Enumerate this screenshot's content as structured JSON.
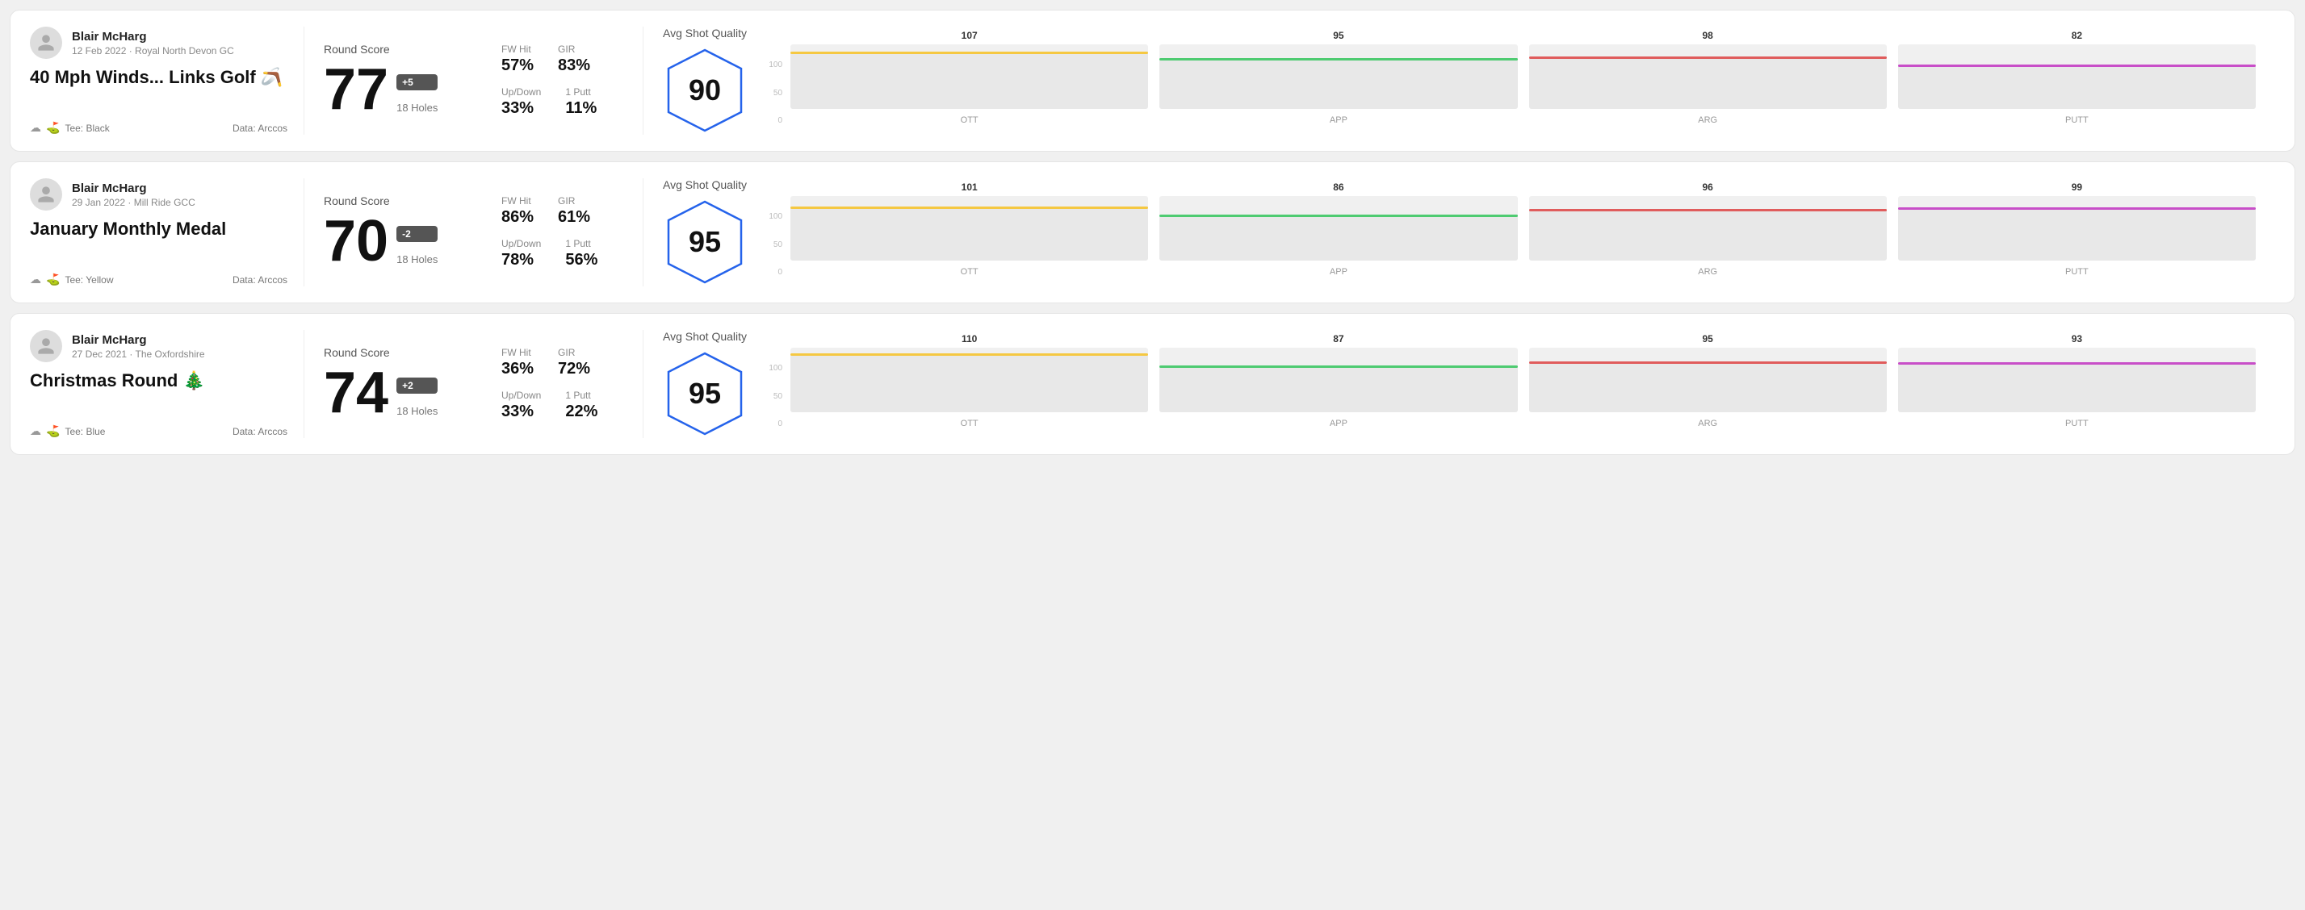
{
  "rounds": [
    {
      "id": "round-1",
      "player": "Blair McHarg",
      "date": "12 Feb 2022 · Royal North Devon GC",
      "title": "40 Mph Winds... Links Golf 🪃",
      "tee": "Black",
      "data_source": "Data: Arccos",
      "round_score_label": "Round Score",
      "score": "77",
      "score_diff": "+5",
      "holes": "18 Holes",
      "fw_hit_label": "FW Hit",
      "fw_hit": "57%",
      "gir_label": "GIR",
      "gir": "83%",
      "updown_label": "Up/Down",
      "updown": "33%",
      "oneputt_label": "1 Putt",
      "oneputt": "11%",
      "quality_label": "Avg Shot Quality",
      "quality_score": "90",
      "bars": [
        {
          "label": "OTT",
          "value": 107,
          "color": "#f5c842"
        },
        {
          "label": "APP",
          "value": 95,
          "color": "#4ecb71"
        },
        {
          "label": "ARG",
          "value": 98,
          "color": "#e05c5c"
        },
        {
          "label": "PUTT",
          "value": 82,
          "color": "#c84ec8"
        }
      ],
      "chart_max": 100
    },
    {
      "id": "round-2",
      "player": "Blair McHarg",
      "date": "29 Jan 2022 · Mill Ride GCC",
      "title": "January Monthly Medal",
      "tee": "Yellow",
      "data_source": "Data: Arccos",
      "round_score_label": "Round Score",
      "score": "70",
      "score_diff": "-2",
      "holes": "18 Holes",
      "fw_hit_label": "FW Hit",
      "fw_hit": "86%",
      "gir_label": "GIR",
      "gir": "61%",
      "updown_label": "Up/Down",
      "updown": "78%",
      "oneputt_label": "1 Putt",
      "oneputt": "56%",
      "quality_label": "Avg Shot Quality",
      "quality_score": "95",
      "bars": [
        {
          "label": "OTT",
          "value": 101,
          "color": "#f5c842"
        },
        {
          "label": "APP",
          "value": 86,
          "color": "#4ecb71"
        },
        {
          "label": "ARG",
          "value": 96,
          "color": "#e05c5c"
        },
        {
          "label": "PUTT",
          "value": 99,
          "color": "#c84ec8"
        }
      ],
      "chart_max": 100
    },
    {
      "id": "round-3",
      "player": "Blair McHarg",
      "date": "27 Dec 2021 · The Oxfordshire",
      "title": "Christmas Round 🎄",
      "tee": "Blue",
      "data_source": "Data: Arccos",
      "round_score_label": "Round Score",
      "score": "74",
      "score_diff": "+2",
      "holes": "18 Holes",
      "fw_hit_label": "FW Hit",
      "fw_hit": "36%",
      "gir_label": "GIR",
      "gir": "72%",
      "updown_label": "Up/Down",
      "updown": "33%",
      "oneputt_label": "1 Putt",
      "oneputt": "22%",
      "quality_label": "Avg Shot Quality",
      "quality_score": "95",
      "bars": [
        {
          "label": "OTT",
          "value": 110,
          "color": "#f5c842"
        },
        {
          "label": "APP",
          "value": 87,
          "color": "#4ecb71"
        },
        {
          "label": "ARG",
          "value": 95,
          "color": "#e05c5c"
        },
        {
          "label": "PUTT",
          "value": 93,
          "color": "#c84ec8"
        }
      ],
      "chart_max": 100
    }
  ]
}
